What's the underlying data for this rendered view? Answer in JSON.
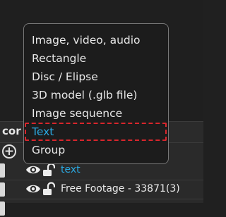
{
  "menu": {
    "items": [
      {
        "label": "Image, video, audio",
        "highlighted": false
      },
      {
        "label": "Rectangle",
        "highlighted": false
      },
      {
        "label": "Disc / Elipse",
        "highlighted": false
      },
      {
        "label": "3D model (.glb file)",
        "highlighted": false
      },
      {
        "label": "Image sequence",
        "highlighted": false
      },
      {
        "label": "Text",
        "highlighted": true
      },
      {
        "label": "Group",
        "highlighted": false
      }
    ]
  },
  "panel": {
    "section_label": "cor",
    "add_icon": "plus-circle-icon"
  },
  "layers": [
    {
      "label": "text",
      "visible_icon": "eye-icon",
      "lock_icon": "lock-open-icon",
      "color": "#2aa8e0"
    },
    {
      "label": "Free Footage - 33871(3)",
      "visible_icon": "eye-icon",
      "lock_icon": "lock-open-icon",
      "color": "#eaeaea"
    }
  ],
  "colors": {
    "accent": "#2aa8e0",
    "highlight_outline": "#d8262c",
    "menu_bg": "#1c1c1c",
    "menu_border": "#777777"
  }
}
